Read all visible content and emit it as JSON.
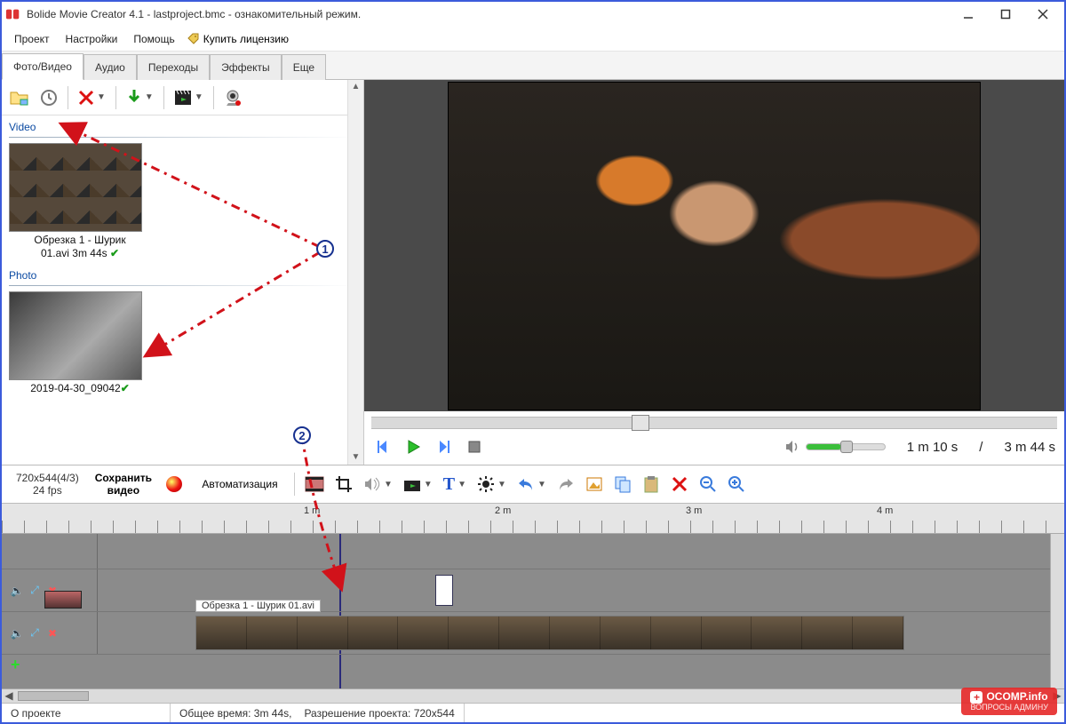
{
  "window": {
    "title": "Bolide Movie Creator 4.1 - lastproject.bmc  - ознакомительный режим."
  },
  "menu": {
    "project": "Проект",
    "settings": "Настройки",
    "help": "Помощь",
    "buy": "Купить лицензию"
  },
  "tabs": {
    "photo_video": "Фото/Видео",
    "audio": "Аудио",
    "transitions": "Переходы",
    "effects": "Эффекты",
    "more": "Еще"
  },
  "media": {
    "video_section": "Video",
    "video_item_line1": "Обрезка 1 - Шурик",
    "video_item_line2": "01.avi 3m 44s",
    "photo_section": "Photo",
    "photo_item": "2019-04-30_09042"
  },
  "playback": {
    "current": "1 m 10 s",
    "separator": "/",
    "total": "3 m 44 s"
  },
  "timeline": {
    "res": "720x544(4/3)",
    "fps": "24 fps",
    "save_top": "Сохранить",
    "save_bottom": "видео",
    "automation": "Автоматизация",
    "mark_1m": "1 m",
    "mark_2m": "2 m",
    "mark_3m": "3 m",
    "mark_4m": "4 m",
    "clip_title": "Обрезка 1 - Шурик 01.avi"
  },
  "status": {
    "about": "О проекте",
    "total_time": "Общее время:  3m 44s,",
    "resolution": "Разрешение проекта:   720x544"
  },
  "annotations": {
    "n1": "1",
    "n2": "2"
  },
  "watermark": {
    "brand": "OCOMP.info",
    "sub": "ВОПРОСЫ АДМИНУ"
  }
}
